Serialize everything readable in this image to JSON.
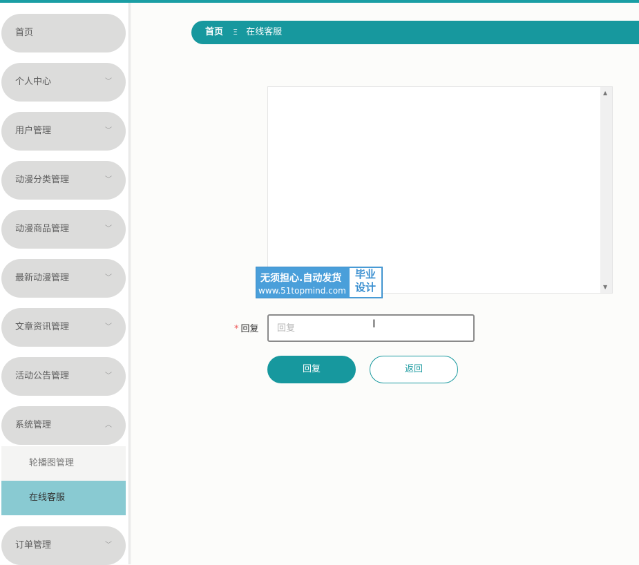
{
  "sidebar": {
    "items": [
      {
        "label": "首页"
      },
      {
        "label": "个人中心",
        "chevron": "chevron-down-icon"
      },
      {
        "label": "用户管理",
        "chevron": "chevron-down-icon"
      },
      {
        "label": "动漫分类管理",
        "chevron": "chevron-down-icon"
      },
      {
        "label": "动漫商品管理",
        "chevron": "chevron-down-icon"
      },
      {
        "label": "最新动漫管理",
        "chevron": "chevron-down-icon"
      },
      {
        "label": "文章资讯管理",
        "chevron": "chevron-down-icon"
      },
      {
        "label": "活动公告管理",
        "chevron": "chevron-down-icon"
      },
      {
        "label": "系统管理",
        "chevron": "chevron-up-icon"
      },
      {
        "label": "订单管理",
        "chevron": "chevron-down-icon"
      }
    ],
    "sub_items": [
      {
        "label": "轮播图管理"
      },
      {
        "label": "在线客服",
        "active": true
      }
    ]
  },
  "breadcrumb": {
    "home": "首页",
    "separator": "Ξ",
    "current": "在线客服"
  },
  "watermark": {
    "line1": "无须担心.自动发货",
    "line2": "www.51topmind.com",
    "right1": "毕业",
    "right2": "设计"
  },
  "form": {
    "required_mark": "*",
    "reply_label": "回复",
    "reply_placeholder": "回复",
    "reply_value": ""
  },
  "buttons": {
    "reply": "回复",
    "back": "返回"
  },
  "colors": {
    "accent": "#17989e",
    "active_sub": "#89cad2",
    "menu_bg": "#dcdcdb"
  }
}
